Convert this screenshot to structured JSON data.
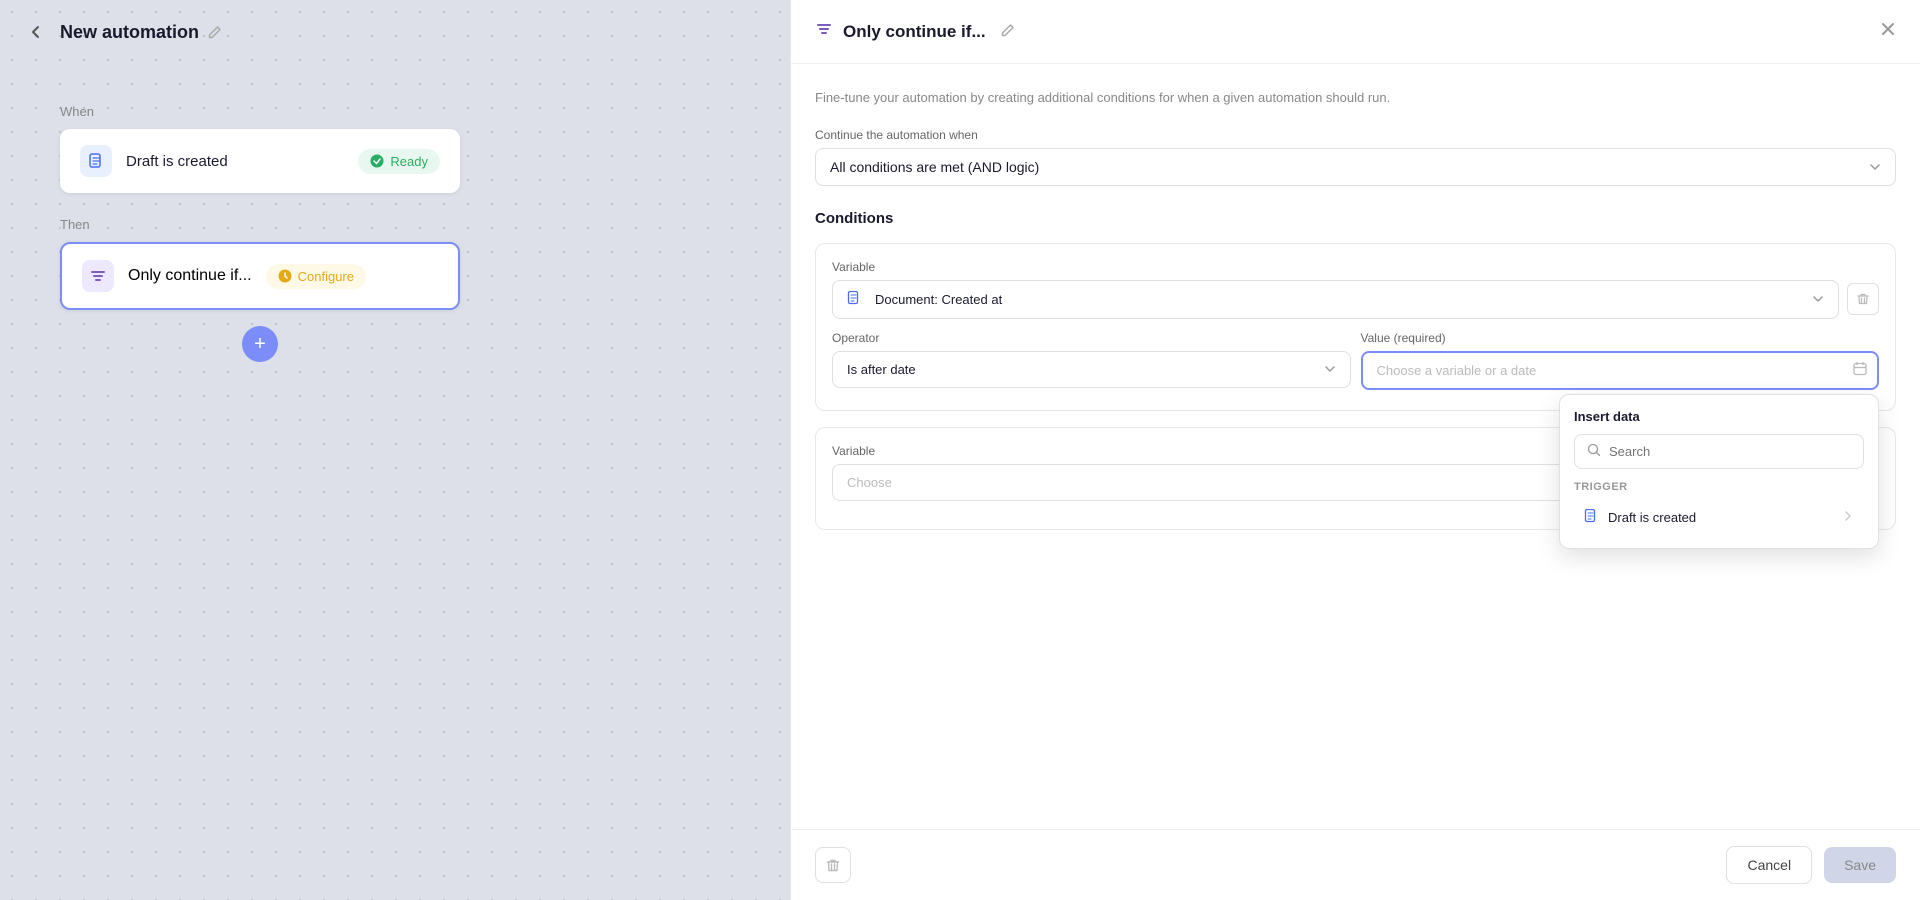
{
  "left": {
    "title": "New automation",
    "when_label": "When",
    "then_label": "Then",
    "trigger_card": {
      "label": "Draft is created",
      "badge": "Ready"
    },
    "then_card": {
      "label": "Only continue if...",
      "badge": "Configure"
    }
  },
  "right": {
    "panel_title": "Only continue if...",
    "description": "Fine-tune your automation by creating additional conditions for when a given automation should run.",
    "continue_label": "Continue the automation when",
    "continue_value": "All conditions are met (AND logic)",
    "conditions_title": "Conditions",
    "variable_label": "Variable",
    "variable_value": "Document: Created at",
    "operator_label": "Operator",
    "operator_value": "Is after date",
    "value_label": "Value (required)",
    "value_placeholder": "Choose a variable or a date",
    "insert_data_title": "Insert data",
    "search_placeholder": "Search",
    "trigger_section": "Trigger",
    "trigger_item": "Draft is created",
    "second_variable_label": "Variable",
    "second_variable_placeholder": "Choose",
    "cancel_label": "Cancel",
    "save_label": "Save"
  },
  "icons": {
    "back": "‹",
    "edit": "✏",
    "close": "✕",
    "check": "✓",
    "filter": "⧫",
    "doc": "📄",
    "chevron_down": "▾",
    "chevron_right": "›",
    "plus": "+",
    "search": "🔍",
    "trash": "🗑",
    "calendar": "📅"
  }
}
